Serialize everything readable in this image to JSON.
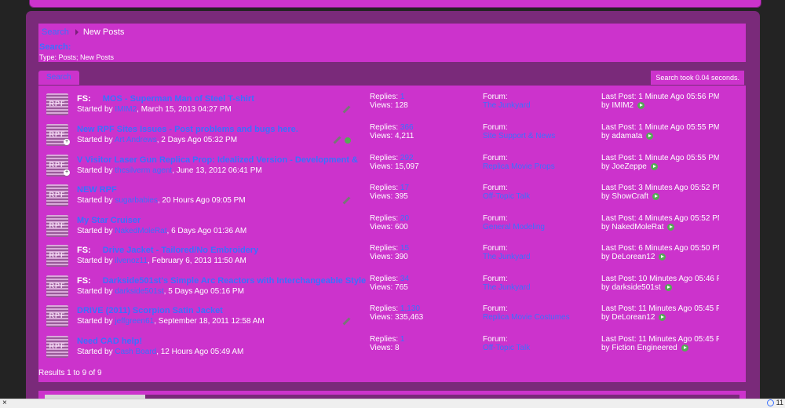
{
  "breadcrumb": {
    "search_link": "Search",
    "current": "New Posts"
  },
  "search": {
    "heading": "Search:",
    "type_line": "Type: Posts; New Posts"
  },
  "tabs": {
    "search_tab": "Search",
    "took": "Search took 0.04 seconds."
  },
  "rows": [
    {
      "prefix": "FS:",
      "title": "MOS - Superman Man of Steel T-shirt",
      "started_prefix": "Started by",
      "author": "IMIM2",
      "date": ", March 15, 2013 04:27 PM",
      "replies_label": "Replies:",
      "replies": "1",
      "views": "Views: 128",
      "forum_label": "Forum:",
      "forum": "The Junkyard",
      "last_post": "Last Post: 1 Minute Ago 05:56 PM",
      "last_by": "by IMIM2",
      "icon_label": "RPF"
    },
    {
      "prefix": "",
      "title": "New RPF Sites Issues - Post problems and bugs here.",
      "started_prefix": "Started by",
      "author": "Art Andrews",
      "date": ", 2 Days Ago 05:32 PM",
      "replies_label": "Replies:",
      "replies": "366",
      "views": "Views: 4,211",
      "forum_label": "Forum:",
      "forum": "Site Support & News",
      "last_post": "Last Post: 1 Minute Ago 05:55 PM",
      "last_by": "by adamata",
      "icon_label": "RPF"
    },
    {
      "prefix": "",
      "title": "V Visitor Laser Gun Replica Prop: Idealized Version - Development &",
      "started_prefix": "Started by",
      "author": "thcsilverm agent",
      "date": ", June 13, 2012 06:41 PM",
      "replies_label": "Replies:",
      "replies": "292",
      "views": "Views: 15,097",
      "forum_label": "Forum:",
      "forum": "Replica Movie Props",
      "last_post": "Last Post: 1 Minute Ago 05:55 PM",
      "last_by": "by JoeZeppe",
      "icon_label": "RPF"
    },
    {
      "prefix": "",
      "title": "NEW RPF",
      "started_prefix": "Started by",
      "author": "sugarbabies",
      "date": ", 20 Hours Ago 09:05 PM",
      "replies_label": "Replies:",
      "replies": "17",
      "views": "Views: 395",
      "forum_label": "Forum:",
      "forum": "Off-Topic Talk",
      "last_post": "Last Post: 3 Minutes Ago 05:52 PM",
      "last_by": "by ShowCraft",
      "icon_label": "RPF"
    },
    {
      "prefix": "",
      "title": "My Star Cruiser",
      "started_prefix": "Started by",
      "author": "NakedMoleRat",
      "date": ", 6 Days Ago 01:36 AM",
      "replies_label": "Replies:",
      "replies": "20",
      "views": "Views: 600",
      "forum_label": "Forum:",
      "forum": "General Modeling",
      "last_post": "Last Post: 4 Minutes Ago 05:52 PM",
      "last_by": "by NakedMoleRat",
      "icon_label": "RPF"
    },
    {
      "prefix": "FS:",
      "title": "Drive Jacket - Tailored/No Embroidery",
      "started_prefix": "Started by",
      "author": "ilvenoz11",
      "date": ", February 6, 2013 11:50 AM",
      "replies_label": "Replies:",
      "replies": "15",
      "views": "Views: 390",
      "forum_label": "Forum:",
      "forum": "The Junkyard",
      "last_post": "Last Post: 6 Minutes Ago 05:50 PM",
      "last_by": "by DeLorean12",
      "icon_label": "RPF"
    },
    {
      "prefix": "FS:",
      "title": "Darkside501st's Simple Arc Reactors with Interchangeable Style",
      "started_prefix": "Started by",
      "author": "darkside501st",
      "date": ", 5 Days Ago 05:16 PM",
      "replies_label": "Replies:",
      "replies": "34",
      "views": "Views: 765",
      "forum_label": "Forum:",
      "forum": "The Junkyard",
      "last_post": "Last Post: 10 Minutes Ago 05:46 PM",
      "last_by": "by darkside501st",
      "icon_label": "RPF"
    },
    {
      "prefix": "",
      "title": "DRIVE (2011) Scorpion Satin Jacket",
      "started_prefix": "Started by",
      "author": "jeffgreen61",
      "date": ", September 18, 2011 12:58 AM",
      "replies_label": "Replies:",
      "replies": "1,130",
      "views": "Views: 335,463",
      "forum_label": "Forum:",
      "forum": "Replica Movie Costumes",
      "last_post": "Last Post: 11 Minutes Ago 05:45 PM",
      "last_by": "by DeLorean12",
      "icon_label": "RPF"
    },
    {
      "prefix": "",
      "title": "Need CAD help!",
      "started_prefix": "Started by",
      "author": "Cash Board",
      "date": ", 12 Hours Ago 05:49 AM",
      "replies_label": "Replies:",
      "replies": "1",
      "views": "Views: 8",
      "forum_label": "Forum:",
      "forum": "Off-Topic Talk",
      "last_post": "Last Post: 11 Minutes Ago 05:45 PM",
      "last_by": "by Fiction Engineered",
      "icon_label": "RPF"
    }
  ],
  "results_count": "Results 1 to 9 of 9",
  "statusbar": {
    "close": "×",
    "zoom": "11"
  }
}
